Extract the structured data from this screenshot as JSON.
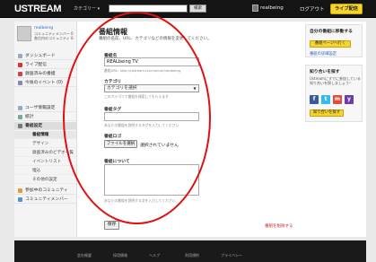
{
  "header": {
    "logo": "USTREAM",
    "category_label": "カテゴリー ▾",
    "search_button": "検索",
    "username": "realbeing",
    "logout": "ログアウト",
    "live_button": "ライブ配信"
  },
  "sidebar": {
    "profile_name": "realbeing",
    "profile_line1": "コミュニティメンバー 0",
    "profile_line2": "各位内のコミュニティ 0",
    "items": [
      {
        "label": "ダッシュボード"
      },
      {
        "label": "ライブ配信"
      },
      {
        "label": "録画済みの番組"
      },
      {
        "label": "今後のイベント (0)"
      },
      {
        "label": "ユーザ情報設定"
      },
      {
        "label": "統計"
      },
      {
        "label": "番組設定"
      }
    ],
    "subitems": [
      {
        "label": "番組情報"
      },
      {
        "label": "デザイン"
      },
      {
        "label": "録画済みのビデオ一覧"
      },
      {
        "label": "イベントリスト"
      },
      {
        "label": "埋込"
      },
      {
        "label": "その他の設定"
      }
    ],
    "bottom_items": [
      {
        "label": "参加中のコミュニティ"
      },
      {
        "label": "コミュニティメンバー"
      }
    ]
  },
  "main": {
    "title": "番組情報",
    "description": "番組の名前、URL、カテゴリなどの情報を変更してください。",
    "name_label": "番組名",
    "name_value": "REALbeing TV",
    "name_hint": "番組URL: http://ustream.tv/channel/realbeing",
    "category_label": "カテゴリ",
    "category_value": "カテゴリを選択",
    "category_hint": "このカテゴリで番組を検索してもらえます",
    "tags_label": "番組タグ",
    "tags_hint": "あなたの番組を説明するタグを入力してください",
    "logo_label": "番組ロゴ",
    "file_button": "ファイルを選択",
    "file_status": "選択されていません",
    "about_label": "番組について",
    "about_hint": "あなたの番組を説明する文を入力してください",
    "save_button": "保存",
    "delete_link": "番組を削除する"
  },
  "rightbar": {
    "box1_title": "自分の番組に移動する",
    "box1_button": "番組ページへ行く",
    "box1_link": "番組の詳細設定",
    "box2_title": "知り合いを探す",
    "box2_text": "Ustreamにすでに参加している知り合いを探しましょう！",
    "box2_button": "知り合いを探す",
    "social": [
      {
        "letter": "f",
        "color": "#3b5998"
      },
      {
        "letter": "t",
        "color": "#33bbee"
      },
      {
        "letter": "m",
        "color": "#e24a3a"
      },
      {
        "letter": "y",
        "color": "#6a3ca8"
      }
    ]
  },
  "footer": {
    "links": [
      "会社概要",
      "採用情報",
      "ヘルプ",
      "利用規約",
      "プライバシー"
    ]
  },
  "colors": {
    "accent": "#f5d430",
    "annotation": "#e01010"
  }
}
